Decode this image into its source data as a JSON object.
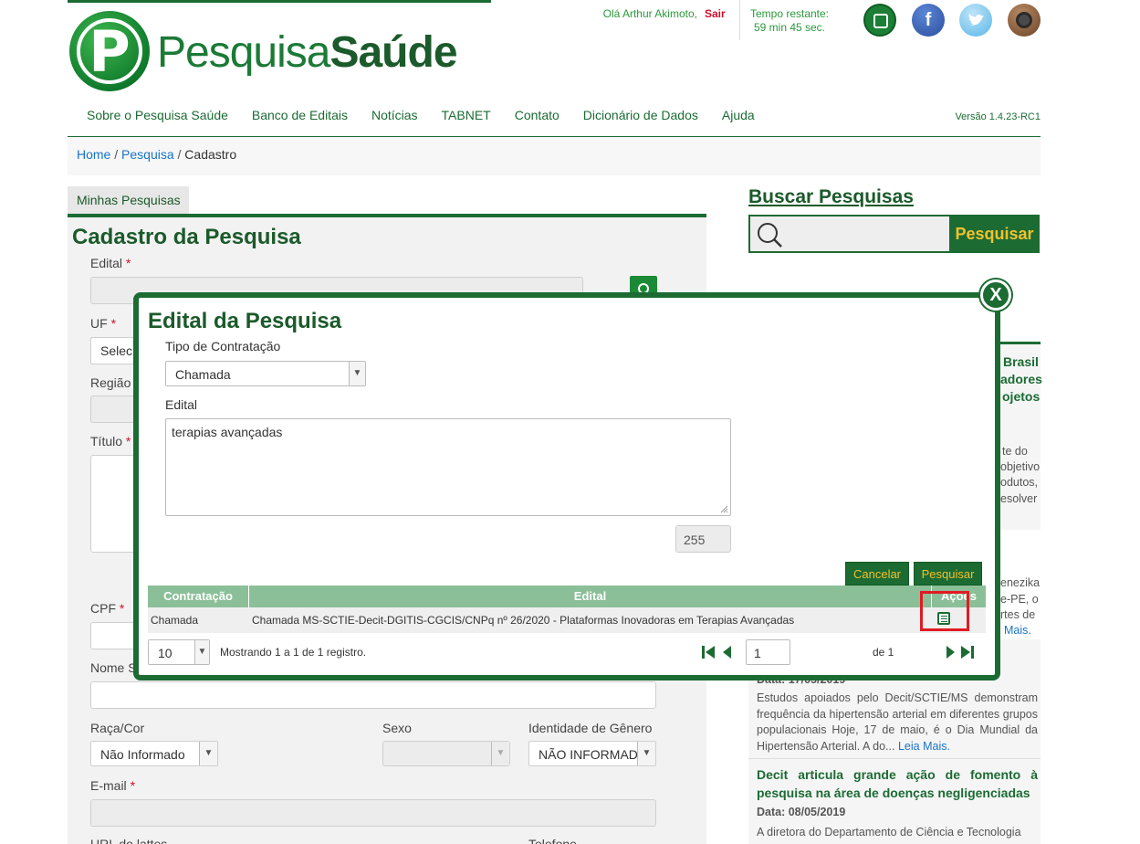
{
  "header": {
    "logo_text_a": "Pesquisa",
    "logo_text_b": "Saúde",
    "logo_letter": "P",
    "greeting": "Olá Arthur Akimoto,",
    "logout": "Sair",
    "time_label": "Tempo restante:",
    "time_value": "59 min 45 sec.",
    "social_icons": [
      "edit-icon",
      "facebook-icon",
      "twitter-icon",
      "instagram-icon"
    ]
  },
  "nav": {
    "items": [
      "Sobre o Pesquisa Saúde",
      "Banco de Editais",
      "Notícias",
      "TABNET",
      "Contato",
      "Dicionário de Dados",
      "Ajuda"
    ],
    "version": "Versão 1.4.23-RC1"
  },
  "breadcrumb": {
    "home": "Home",
    "sep1": " / ",
    "pesquisa": "Pesquisa",
    "sep2": " / ",
    "current": "Cadastro"
  },
  "form": {
    "tab": "Minhas Pesquisas",
    "title": "Cadastro da Pesquisa",
    "edital_label": "Edital",
    "uf_label": "UF",
    "uf_value": "Selec",
    "regiao_label": "Região",
    "titulo_label": "Título",
    "cpf_label": "CPF",
    "nome_label": "Nome S",
    "raca_label": "Raça/Cor",
    "raca_value": "Não Informado",
    "sexo_label": "Sexo",
    "genero_label": "Identidade de Gênero",
    "genero_value": "NÃO INFORMADA",
    "email_label": "E-mail",
    "lattes_label": "URL do lattes",
    "telefone_label": "Telefone",
    "required_mark": "*"
  },
  "sidebar": {
    "search_title": "Buscar Pesquisas",
    "search_button": "Pesquisar",
    "news_fragments": {
      "h1_a": "Brasil",
      "h1_b": "adores",
      "h1_c": "ojetos",
      "p1_a": "te do",
      "p1_b": "objetivo",
      "p1_c": "odutos,",
      "p1_d": "esolver",
      "p2_a": "enezika",
      "p2_b": "e-PE, o",
      "p2_c": "rtes de",
      "p2_leia": "Mais."
    },
    "news": [
      {
        "date": "Data: 17/05/2019",
        "text": "Estudos apoiados pelo Decit/SCTIE/MS demonstram frequência da hipertensão arterial em diferentes grupos populacionais   Hoje, 17 de maio, é o Dia Mundial da Hipertensão Arterial. A do...",
        "more": "Leia Mais."
      },
      {
        "title": "Decit articula grande ação de fomento à pesquisa na área de doenças negligenciadas",
        "date": "Data: 08/05/2019",
        "text": "A diretora do Departamento de Ciência e Tecnologia"
      }
    ]
  },
  "modal": {
    "close": "X",
    "title": "Edital da Pesquisa",
    "tipo_label": "Tipo de Contratação",
    "tipo_value": "Chamada",
    "edital_label": "Edital",
    "edital_value": "terapias avançadas",
    "char_count": "255",
    "cancel_button": "Cancelar",
    "search_button": "Pesquisar",
    "table": {
      "headers": [
        "Contratação",
        "Edital",
        "Ações"
      ],
      "rows": [
        {
          "contratacao": "Chamada",
          "edital": "Chamada MS-SCTIE-Decit-DGITIS-CGCIS/CNPq nº 26/2020 - Plataformas Inovadoras em Terapias Avançadas",
          "action_icon": "select-document-icon"
        }
      ]
    },
    "pagination": {
      "page_size": "10",
      "summary": "Mostrando 1 a 1 de 1 registro.",
      "page": "1",
      "of": "de 1"
    }
  },
  "colors": {
    "brand_green": "#1b6b33",
    "accent_yellow": "#f2c12e",
    "highlight_red": "#e11b22",
    "link_blue": "#1a73c9"
  }
}
